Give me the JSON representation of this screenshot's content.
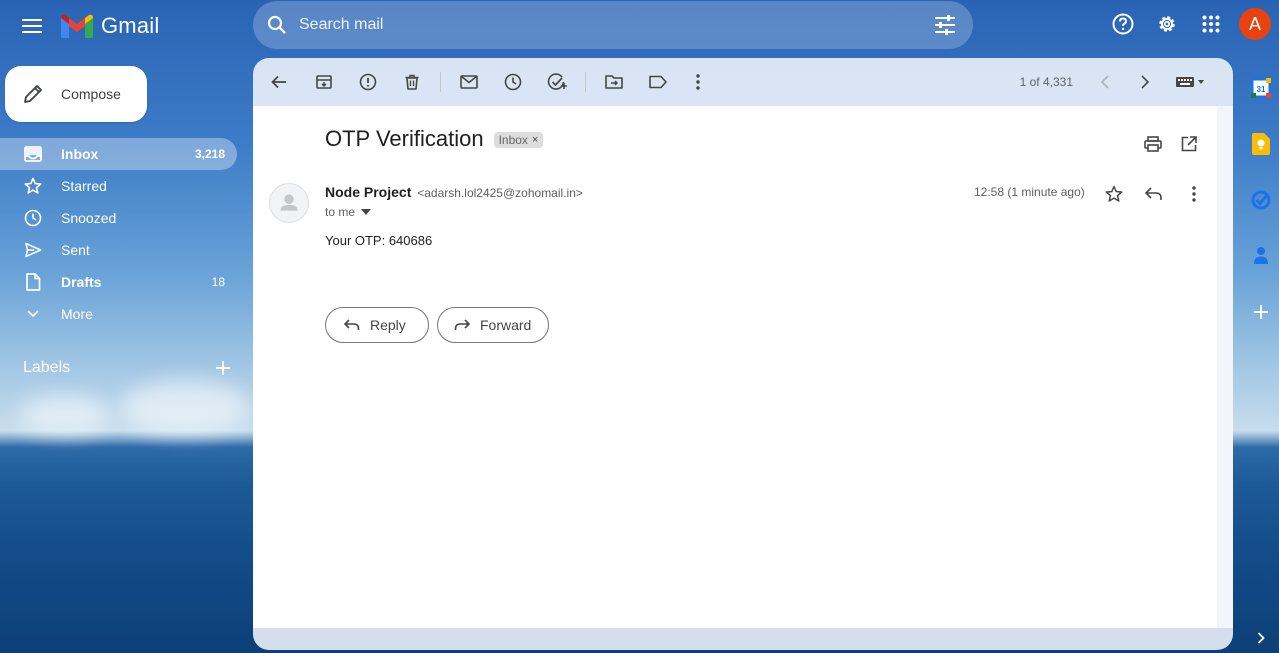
{
  "app": {
    "name": "Gmail"
  },
  "search": {
    "placeholder": "Search mail"
  },
  "user": {
    "avatar_letter": "A",
    "avatar_color": "#e8430f"
  },
  "compose": {
    "label": "Compose"
  },
  "sidebar": {
    "items": [
      {
        "label": "Inbox",
        "count": "3,218",
        "icon": "inbox-icon",
        "active": true
      },
      {
        "label": "Starred",
        "count": "",
        "icon": "star-icon"
      },
      {
        "label": "Snoozed",
        "count": "",
        "icon": "clock-icon"
      },
      {
        "label": "Sent",
        "count": "",
        "icon": "send-icon"
      },
      {
        "label": "Drafts",
        "count": "18",
        "icon": "draft-icon"
      },
      {
        "label": "More",
        "count": "",
        "icon": "chevron-down-icon"
      }
    ],
    "labels_title": "Labels"
  },
  "toolbar": {
    "pager": "1 of 4,331"
  },
  "message": {
    "subject": "OTP Verification",
    "label_chip": "Inbox",
    "label_chip_close": "×",
    "sender_name": "Node Project",
    "sender_email": "<adarsh.lol2425@zohomail.in>",
    "to": "to me",
    "time": "12:58 (1 minute ago)",
    "body": "Your OTP: 640686"
  },
  "actions": {
    "reply_label": "Reply",
    "forward_label": "Forward"
  },
  "side_apps": {
    "calendar_day": "31"
  },
  "colors": {
    "accent_blue": "#0b57d0",
    "keep_yellow": "#fbbc04",
    "tasks_blue": "#1a73e8",
    "contacts_blue": "#1a73e8"
  }
}
